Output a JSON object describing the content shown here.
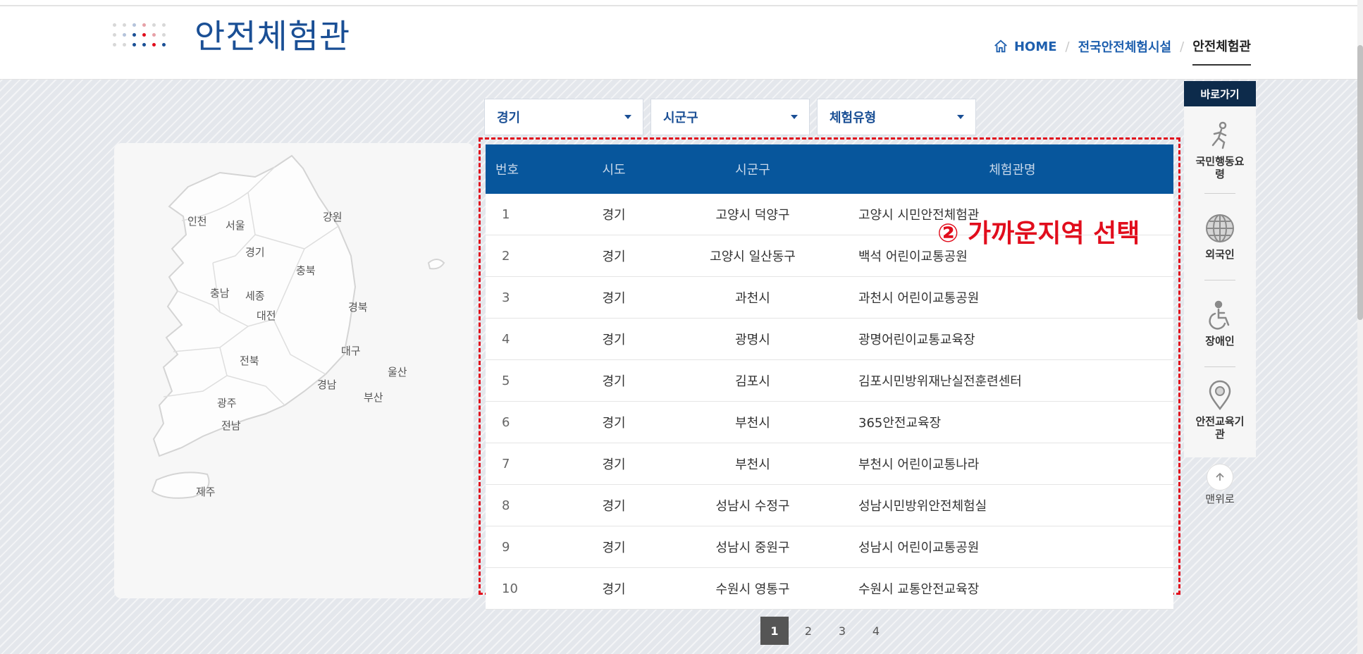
{
  "header": {
    "title": "안전체험관",
    "breadcrumb": {
      "home": "HOME",
      "middle": "전국안전체험시설",
      "current": "안전체험관"
    }
  },
  "filters": [
    {
      "label": "경기"
    },
    {
      "label": "시군구"
    },
    {
      "label": "체험유형"
    }
  ],
  "map": {
    "regions": [
      "인천",
      "서울",
      "강원",
      "경기",
      "충북",
      "충남",
      "세종",
      "대전",
      "경북",
      "대구",
      "전북",
      "울산",
      "경남",
      "부산",
      "광주",
      "전남",
      "제주"
    ]
  },
  "table": {
    "headers": {
      "num": "번호",
      "sido": "시도",
      "sigungu": "시군구",
      "name": "체험관명"
    },
    "rows": [
      {
        "num": "1",
        "sido": "경기",
        "sigungu": "고양시 덕양구",
        "name": "고양시 시민안전체험관"
      },
      {
        "num": "2",
        "sido": "경기",
        "sigungu": "고양시 일산동구",
        "name": "백석 어린이교통공원"
      },
      {
        "num": "3",
        "sido": "경기",
        "sigungu": "과천시",
        "name": "과천시 어린이교통공원"
      },
      {
        "num": "4",
        "sido": "경기",
        "sigungu": "광명시",
        "name": "광명어린이교통교육장"
      },
      {
        "num": "5",
        "sido": "경기",
        "sigungu": "김포시",
        "name": "김포시민방위재난실전훈련센터"
      },
      {
        "num": "6",
        "sido": "경기",
        "sigungu": "부천시",
        "name": "365안전교육장"
      },
      {
        "num": "7",
        "sido": "경기",
        "sigungu": "부천시",
        "name": "부천시 어린이교통나라"
      },
      {
        "num": "8",
        "sido": "경기",
        "sigungu": "성남시 수정구",
        "name": "성남시민방위안전체험실"
      },
      {
        "num": "9",
        "sido": "경기",
        "sigungu": "성남시 중원구",
        "name": "성남시 어린이교통공원"
      },
      {
        "num": "10",
        "sido": "경기",
        "sigungu": "수원시 영통구",
        "name": "수원시 교통안전교육장"
      }
    ]
  },
  "annotation": "② 가까운지역 선택",
  "pagination": {
    "pages": [
      "1",
      "2",
      "3",
      "4"
    ],
    "active": "1"
  },
  "quick_menu": {
    "title": "바로가기",
    "items": [
      {
        "label": "국민행동요령",
        "icon": "person-running-icon"
      },
      {
        "label": "외국인",
        "icon": "globe-icon"
      },
      {
        "label": "장애인",
        "icon": "wheelchair-icon"
      },
      {
        "label": "안전교육기관",
        "icon": "location-pin-icon"
      }
    ],
    "top_label": "맨위로"
  },
  "colors": {
    "brand": "#1a4f95",
    "table_header": "#07569c",
    "annotation": "#e10d1c",
    "quick_head": "#0d2b4b"
  }
}
